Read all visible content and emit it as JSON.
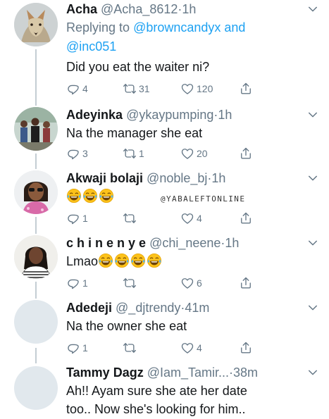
{
  "watermark": "@YABALEFTONLINE",
  "tweets": [
    {
      "name": "Acha",
      "handle": "@Acha_8612",
      "sep": "·",
      "time": "1h",
      "reply_prefix": "Replying to ",
      "reply_user1": "@browncandyx",
      "reply_and": " and",
      "reply_user2": "@inc051",
      "text": "Did you eat the waiter ni?",
      "replies": "4",
      "retweets": "31",
      "likes": "120",
      "avatar": "fox-avatar"
    },
    {
      "name": "Adeyinka",
      "handle": "@ykaypumping",
      "sep": "·",
      "time": "1h",
      "text": "Na the manager she eat",
      "replies": "3",
      "retweets": "1",
      "likes": "20",
      "avatar": "crowd-avatar"
    },
    {
      "name": "Akwaji bolaji",
      "handle": "@noble_bj",
      "sep": "·",
      "time": "1h",
      "text": "",
      "emojis": [
        "joy-emoji",
        "joy-emoji",
        "joy-emoji"
      ],
      "replies": "1",
      "retweets": "",
      "likes": "4",
      "avatar": "woman-sunglasses-avatar"
    },
    {
      "name": "c h i n e n y e",
      "handle": "@chi_neene",
      "sep": "·",
      "time": "1h",
      "text": "Lmao",
      "emojis": [
        "joy-emoji",
        "joy-emoji",
        "joy-emoji",
        "joy-emoji"
      ],
      "replies": "1",
      "retweets": "",
      "likes": "6",
      "avatar": "woman-portrait-avatar"
    },
    {
      "name": "Adedeji",
      "handle": "@_djtrendy",
      "sep": "·",
      "time": "41m",
      "text": "Na the owner she eat",
      "replies": "1",
      "retweets": "",
      "likes": "4",
      "avatar": "default-avatar"
    },
    {
      "name": "Tammy Dagz",
      "handle": "@Iam_Tamir...",
      "sep": "·",
      "time": "38m",
      "text_line1": "Ah!! Ayam sure she ate her date",
      "text_line2": "too.. Now she's looking for him..",
      "avatar": "default-avatar"
    }
  ],
  "colors": {
    "text": "#14171a",
    "secondary": "#657786",
    "link": "#1da1f2",
    "thread": "#c4cdd4"
  }
}
